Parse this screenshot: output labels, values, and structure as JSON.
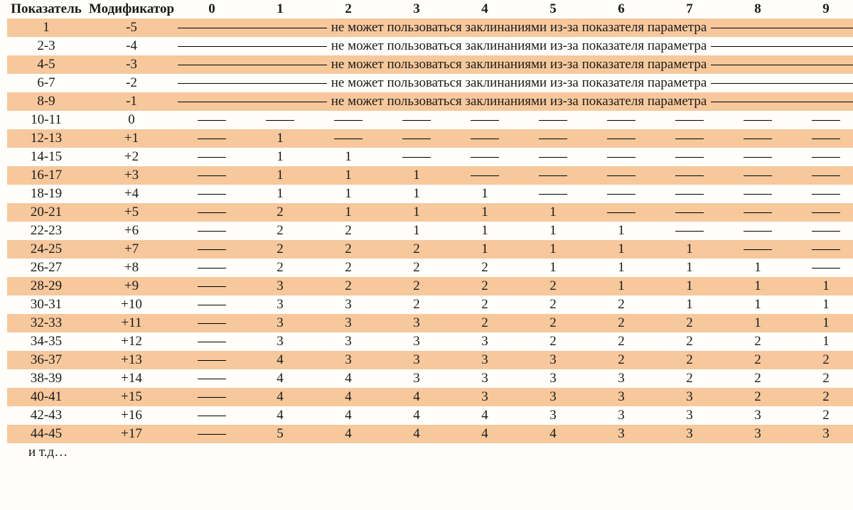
{
  "headers": {
    "stat": "Показатель",
    "mod": "Модификатор",
    "levels": [
      "0",
      "1",
      "2",
      "3",
      "4",
      "5",
      "6",
      "7",
      "8",
      "9"
    ]
  },
  "cannot_message": "не   может пользоваться заклинаниями из-за показателя параметра",
  "footer": "и т.д…",
  "chart_data": {
    "type": "table",
    "dash_means": "—",
    "columns": [
      "Показатель",
      "Модификатор",
      "0",
      "1",
      "2",
      "3",
      "4",
      "5",
      "6",
      "7",
      "8",
      "9"
    ],
    "rows": [
      {
        "stat": "1",
        "mod": "-5",
        "cells": "msg"
      },
      {
        "stat": "2-3",
        "mod": "-4",
        "cells": "msg"
      },
      {
        "stat": "4-5",
        "mod": "-3",
        "cells": "msg"
      },
      {
        "stat": "6-7",
        "mod": "-2",
        "cells": "msg"
      },
      {
        "stat": "8-9",
        "mod": "-1",
        "cells": "msg"
      },
      {
        "stat": "10-11",
        "mod": "0",
        "cells": [
          "—",
          "—",
          "—",
          "—",
          "—",
          "—",
          "—",
          "—",
          "—",
          "—"
        ]
      },
      {
        "stat": "12-13",
        "mod": "+1",
        "cells": [
          "—",
          "1",
          "—",
          "—",
          "—",
          "—",
          "—",
          "—",
          "—",
          "—"
        ]
      },
      {
        "stat": "14-15",
        "mod": "+2",
        "cells": [
          "—",
          "1",
          "1",
          "—",
          "—",
          "—",
          "—",
          "—",
          "—",
          "—"
        ]
      },
      {
        "stat": "16-17",
        "mod": "+3",
        "cells": [
          "—",
          "1",
          "1",
          "1",
          "—",
          "—",
          "—",
          "—",
          "—",
          "—"
        ]
      },
      {
        "stat": "18-19",
        "mod": "+4",
        "cells": [
          "—",
          "1",
          "1",
          "1",
          "1",
          "—",
          "—",
          "—",
          "—",
          "—"
        ]
      },
      {
        "stat": "20-21",
        "mod": "+5",
        "cells": [
          "—",
          "2",
          "1",
          "1",
          "1",
          "1",
          "—",
          "—",
          "—",
          "—"
        ]
      },
      {
        "stat": "22-23",
        "mod": "+6",
        "cells": [
          "—",
          "2",
          "2",
          "1",
          "1",
          "1",
          "1",
          "—",
          "—",
          "—"
        ]
      },
      {
        "stat": "24-25",
        "mod": "+7",
        "cells": [
          "—",
          "2",
          "2",
          "2",
          "1",
          "1",
          "1",
          "1",
          "—",
          "—"
        ]
      },
      {
        "stat": "26-27",
        "mod": "+8",
        "cells": [
          "—",
          "2",
          "2",
          "2",
          "2",
          "1",
          "1",
          "1",
          "1",
          "—"
        ]
      },
      {
        "stat": "28-29",
        "mod": "+9",
        "cells": [
          "—",
          "3",
          "2",
          "2",
          "2",
          "2",
          "1",
          "1",
          "1",
          "1"
        ]
      },
      {
        "stat": "30-31",
        "mod": "+10",
        "cells": [
          "—",
          "3",
          "3",
          "2",
          "2",
          "2",
          "2",
          "1",
          "1",
          "1"
        ]
      },
      {
        "stat": "32-33",
        "mod": "+11",
        "cells": [
          "—",
          "3",
          "3",
          "3",
          "2",
          "2",
          "2",
          "2",
          "1",
          "1"
        ]
      },
      {
        "stat": "34-35",
        "mod": "+12",
        "cells": [
          "—",
          "3",
          "3",
          "3",
          "3",
          "2",
          "2",
          "2",
          "2",
          "1"
        ]
      },
      {
        "stat": "36-37",
        "mod": "+13",
        "cells": [
          "—",
          "4",
          "3",
          "3",
          "3",
          "3",
          "2",
          "2",
          "2",
          "2"
        ]
      },
      {
        "stat": "38-39",
        "mod": "+14",
        "cells": [
          "—",
          "4",
          "4",
          "3",
          "3",
          "3",
          "3",
          "2",
          "2",
          "2"
        ]
      },
      {
        "stat": "40-41",
        "mod": "+15",
        "cells": [
          "—",
          "4",
          "4",
          "4",
          "3",
          "3",
          "3",
          "3",
          "2",
          "2"
        ]
      },
      {
        "stat": "42-43",
        "mod": "+16",
        "cells": [
          "—",
          "4",
          "4",
          "4",
          "4",
          "3",
          "3",
          "3",
          "3",
          "2"
        ]
      },
      {
        "stat": "44-45",
        "mod": "+17",
        "cells": [
          "—",
          "5",
          "4",
          "4",
          "4",
          "4",
          "3",
          "3",
          "3",
          "3"
        ]
      }
    ]
  }
}
